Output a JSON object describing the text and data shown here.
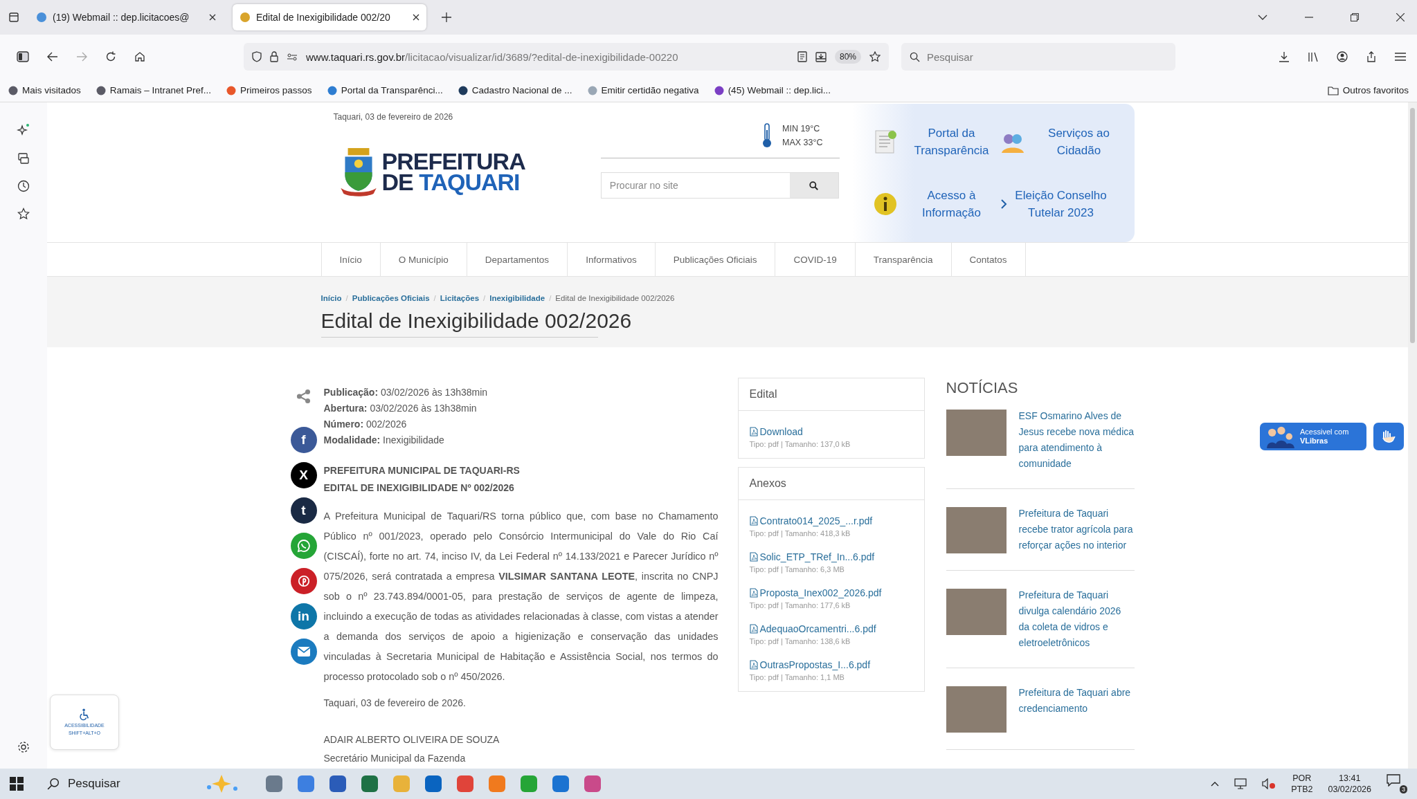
{
  "browser": {
    "tabs": [
      {
        "title": "(19) Webmail :: dep.licitacoes@",
        "selected": false,
        "color": "#4a90d9"
      },
      {
        "title": "Edital de Inexigibilidade 002/20",
        "selected": true,
        "color": "#d9a42b"
      }
    ],
    "url_domain": "www.taquari.rs.gov.br",
    "url_path": "/licitacao/visualizar/id/3689/?edital-de-inexigibilidade-00220",
    "zoom": "80%",
    "search_placeholder": "Pesquisar",
    "bookmarks": [
      {
        "label": "Mais visitados",
        "color": "#5b5b66"
      },
      {
        "label": "Ramais – Intranet Pref...",
        "color": "#5b5b66"
      },
      {
        "label": "Primeiros passos",
        "color": "#e8572a"
      },
      {
        "label": "Portal da Transparênci...",
        "color": "#2e7dd1"
      },
      {
        "label": "Cadastro Nacional de ...",
        "color": "#1f3b5c"
      },
      {
        "label": "Emitir certidão negativa",
        "color": "#9aa7b5"
      },
      {
        "label": "(45) Webmail :: dep.lici...",
        "color": "#7b3fc4"
      }
    ],
    "other_bookmarks": "Outros favoritos"
  },
  "header": {
    "date": "Taquari, 03 de fevereiro de 2026",
    "logo_top": "PREFEITURA",
    "logo_de": "DE",
    "logo_name": "TAQUARI",
    "temp_min": "MIN 19°C",
    "temp_max": "MAX 33°C",
    "search_placeholder": "Procurar no site",
    "quick_links": [
      {
        "label": "Portal da Transparência",
        "kind": "document"
      },
      {
        "label": "Serviços ao Cidadão",
        "kind": "people"
      },
      {
        "label": "Acesso à Informação",
        "kind": "info"
      },
      {
        "label": "Eleição Conselho Tutelar 2023",
        "kind": "chevron"
      }
    ]
  },
  "nav": [
    "Início",
    "O Município",
    "Departamentos",
    "Informativos",
    "Publicações Oficiais",
    "COVID-19",
    "Transparência",
    "Contatos"
  ],
  "breadcrumb": [
    {
      "label": "Início",
      "link": true
    },
    {
      "label": "Publicações Oficiais",
      "link": true
    },
    {
      "label": "Licitações",
      "link": true
    },
    {
      "label": "Inexigibilidade",
      "link": true
    },
    {
      "label": "Edital de Inexigibilidade 002/2026",
      "link": false
    }
  ],
  "breadcrumb_separator": "/",
  "title": "Edital de Inexigibilidade 002/2026",
  "share": [
    {
      "kind": "glyph",
      "glyph": "f",
      "color": "#3b5998"
    },
    {
      "kind": "glyph",
      "glyph": "X",
      "color": "#000000"
    },
    {
      "kind": "glyph",
      "glyph": "t",
      "color": "#1a2a44"
    },
    {
      "kind": "chat",
      "color": "#25a537"
    },
    {
      "kind": "pin",
      "color": "#cb2027"
    },
    {
      "kind": "glyph",
      "glyph": "in",
      "color": "#0e76a8"
    },
    {
      "kind": "mail",
      "color": "#1b7bbf"
    }
  ],
  "details": [
    {
      "label": "Publicação:",
      "value": "03/02/2026 às 13h38min"
    },
    {
      "label": "Abertura:",
      "value": "03/02/2026 às 13h38min"
    },
    {
      "label": "Número:",
      "value": "002/2026"
    },
    {
      "label": "Modalidade:",
      "value": "Inexigibilidade"
    }
  ],
  "headings": [
    "PREFEITURA MUNICIPAL DE TAQUARI-RS",
    "EDITAL DE INEXIGIBILIDADE Nº 002/2026"
  ],
  "body": " A Prefeitura Municipal de Taquari/RS torna público que, com base no Chamamento Público nº 001/2023, operado pelo Consórcio Intermunicipal do Vale do Rio Caí (CISCAÍ), forte no art. 74, inciso IV, da Lei Federal nº 14.133/2021 e Parecer Jurídico nº 075/2026, será contratada a empresa  **VILSIMAR SANTANA LEOTE**, inscrita no CNPJ sob o nº 23.743.894/0001-05, para prestação de serviços de agente de limpeza, incluindo a execução de todas as atividades relacionadas à classe, com vistas a atender a demanda dos serviços de apoio a higienização e conservação das unidades vinculadas à Secretaria Municipal de Habitação e Assistência Social, nos termos do processo protocolado sob o nº 450/2026.",
  "place_date": "Taquari, 03 de fevereiro de 2026.",
  "signature_name": "ADAIR ALBERTO OLIVEIRA DE SOUZA",
  "signature_role": "Secretário Municipal da Fazenda",
  "cards": [
    {
      "title": "Edital",
      "files": [
        {
          "name": "Download",
          "meta": "Tipo: pdf | Tamanho: 137,0 kB"
        }
      ]
    },
    {
      "title": "Anexos",
      "files": [
        {
          "name": "Contrato014_2025_...r.pdf",
          "meta": "Tipo: pdf | Tamanho: 418,3 kB"
        },
        {
          "name": "Solic_ETP_TRef_In...6.pdf",
          "meta": "Tipo: pdf | Tamanho: 6,3 MB"
        },
        {
          "name": "Proposta_Inex002_2026.pdf",
          "meta": "Tipo: pdf | Tamanho: 177,6 kB"
        },
        {
          "name": "AdequaoOrcamentri...6.pdf",
          "meta": "Tipo: pdf | Tamanho: 138,6 kB"
        },
        {
          "name": "OutrasPropostas_I...6.pdf",
          "meta": "Tipo: pdf | Tamanho: 1,1 MB"
        }
      ]
    }
  ],
  "news": {
    "title": "NOTÍCIAS",
    "items": [
      "ESF Osmarino Alves de Jesus recebe nova médica para atendimento à comunidade",
      "Prefeitura de Taquari recebe trator agrícola para reforçar ações no interior",
      "Prefeitura de Taquari divulga calendário 2026 da coleta de vidros e eletroeletrônicos",
      "Prefeitura de Taquari abre credenciamento"
    ]
  },
  "accessibility": {
    "title": "ACESSIBILIDADE",
    "shortcut": "SHIFT+ALT+O"
  },
  "vlibras": {
    "line1": "Acessivel com",
    "line2": "VLibras"
  },
  "taskbar": {
    "search": "Pesquisar",
    "lang": "POR",
    "layout": "PTB2",
    "time": "13:41",
    "date": "03/02/2026",
    "notifications": "3"
  }
}
